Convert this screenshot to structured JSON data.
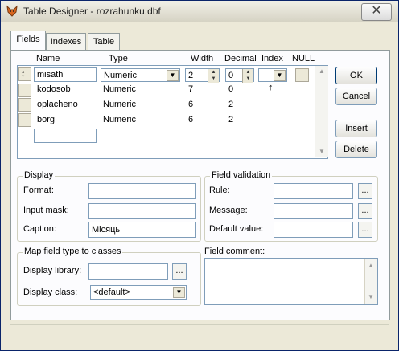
{
  "window": {
    "title": "Table Designer - rozrahunku.dbf",
    "close_glyph": "✕"
  },
  "tabs": [
    {
      "label": "Fields"
    },
    {
      "label": "Indexes"
    },
    {
      "label": "Table"
    }
  ],
  "columns": {
    "name": "Name",
    "type": "Type",
    "width": "Width",
    "decimal": "Decimal",
    "index": "Index",
    "null": "NULL"
  },
  "rows": [
    {
      "name": "misath",
      "type": "Numeric",
      "width": "2",
      "decimal": "0",
      "index": "",
      "selector": "↕"
    },
    {
      "name": "kodosob",
      "type": "Numeric",
      "width": "7",
      "decimal": "0",
      "index": "↑",
      "selector": ""
    },
    {
      "name": "oplacheno",
      "type": "Numeric",
      "width": "6",
      "decimal": "2",
      "index": "",
      "selector": ""
    },
    {
      "name": "borg",
      "type": "Numeric",
      "width": "6",
      "decimal": "2",
      "index": "",
      "selector": ""
    }
  ],
  "new_row": {
    "name": ""
  },
  "buttons": {
    "ok": "OK",
    "cancel": "Cancel",
    "insert": "Insert",
    "delete": "Delete"
  },
  "display": {
    "title": "Display",
    "format_label": "Format:",
    "format_value": "",
    "input_mask_label": "Input mask:",
    "input_mask_value": "",
    "caption_label": "Caption:",
    "caption_value": "Місяць"
  },
  "validation": {
    "title": "Field validation",
    "rule_label": "Rule:",
    "rule_value": "",
    "message_label": "Message:",
    "message_value": "",
    "default_label": "Default value:",
    "default_value": ""
  },
  "map": {
    "title": "Map field type to classes",
    "library_label": "Display library:",
    "library_value": "",
    "class_label": "Display class:",
    "class_value": "<default>"
  },
  "comment": {
    "label": "Field comment:",
    "value": ""
  },
  "icons": {
    "dots": "...",
    "dropdown": "▼",
    "scroll_up": "▲",
    "scroll_down": "▼"
  }
}
